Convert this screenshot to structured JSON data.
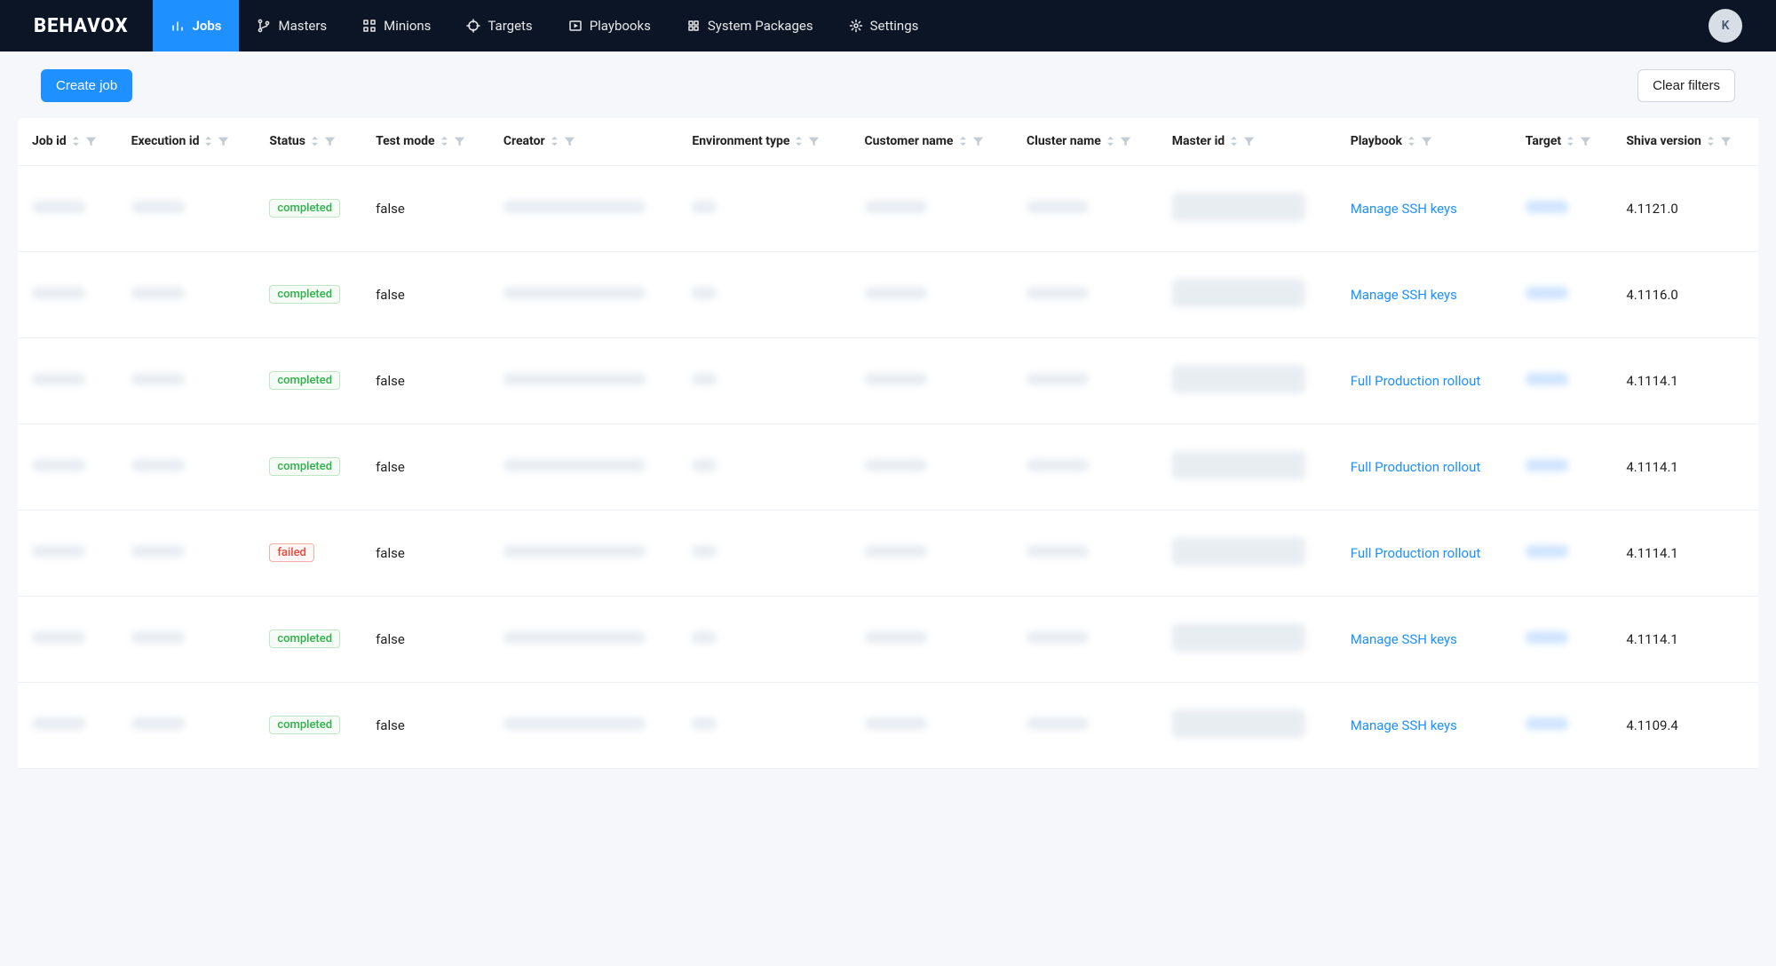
{
  "brand": "BEHAVOX",
  "nav": {
    "items": [
      {
        "key": "jobs",
        "label": "Jobs",
        "icon": "bar-chart",
        "active": true
      },
      {
        "key": "masters",
        "label": "Masters",
        "icon": "branch",
        "active": false
      },
      {
        "key": "minions",
        "label": "Minions",
        "icon": "grid",
        "active": false
      },
      {
        "key": "targets",
        "label": "Targets",
        "icon": "crosshair",
        "active": false
      },
      {
        "key": "playbooks",
        "label": "Playbooks",
        "icon": "play",
        "active": false
      },
      {
        "key": "packages",
        "label": "System Packages",
        "icon": "package",
        "active": false
      },
      {
        "key": "settings",
        "label": "Settings",
        "icon": "gear",
        "active": false
      }
    ]
  },
  "avatar_initial": "K",
  "toolbar": {
    "create_label": "Create job",
    "clear_label": "Clear filters"
  },
  "table": {
    "columns": [
      {
        "key": "job_id",
        "label": "Job id"
      },
      {
        "key": "execution_id",
        "label": "Execution id"
      },
      {
        "key": "status",
        "label": "Status"
      },
      {
        "key": "test_mode",
        "label": "Test mode"
      },
      {
        "key": "creator",
        "label": "Creator"
      },
      {
        "key": "env_type",
        "label": "Environment type"
      },
      {
        "key": "customer",
        "label": "Customer name"
      },
      {
        "key": "cluster",
        "label": "Cluster name"
      },
      {
        "key": "master_id",
        "label": "Master id"
      },
      {
        "key": "playbook",
        "label": "Playbook"
      },
      {
        "key": "target",
        "label": "Target"
      },
      {
        "key": "shiva",
        "label": "Shiva version"
      }
    ],
    "rows": [
      {
        "status": "completed",
        "test_mode": "false",
        "playbook": "Manage SSH keys",
        "shiva": "4.1121.0"
      },
      {
        "status": "completed",
        "test_mode": "false",
        "playbook": "Manage SSH keys",
        "shiva": "4.1116.0"
      },
      {
        "status": "completed",
        "test_mode": "false",
        "playbook": "Full Production rollout",
        "shiva": "4.1114.1"
      },
      {
        "status": "completed",
        "test_mode": "false",
        "playbook": "Full Production rollout",
        "shiva": "4.1114.1"
      },
      {
        "status": "failed",
        "test_mode": "false",
        "playbook": "Full Production rollout",
        "shiva": "4.1114.1"
      },
      {
        "status": "completed",
        "test_mode": "false",
        "playbook": "Manage SSH keys",
        "shiva": "4.1114.1"
      },
      {
        "status": "completed",
        "test_mode": "false",
        "playbook": "Manage SSH keys",
        "shiva": "4.1109.4"
      }
    ]
  }
}
